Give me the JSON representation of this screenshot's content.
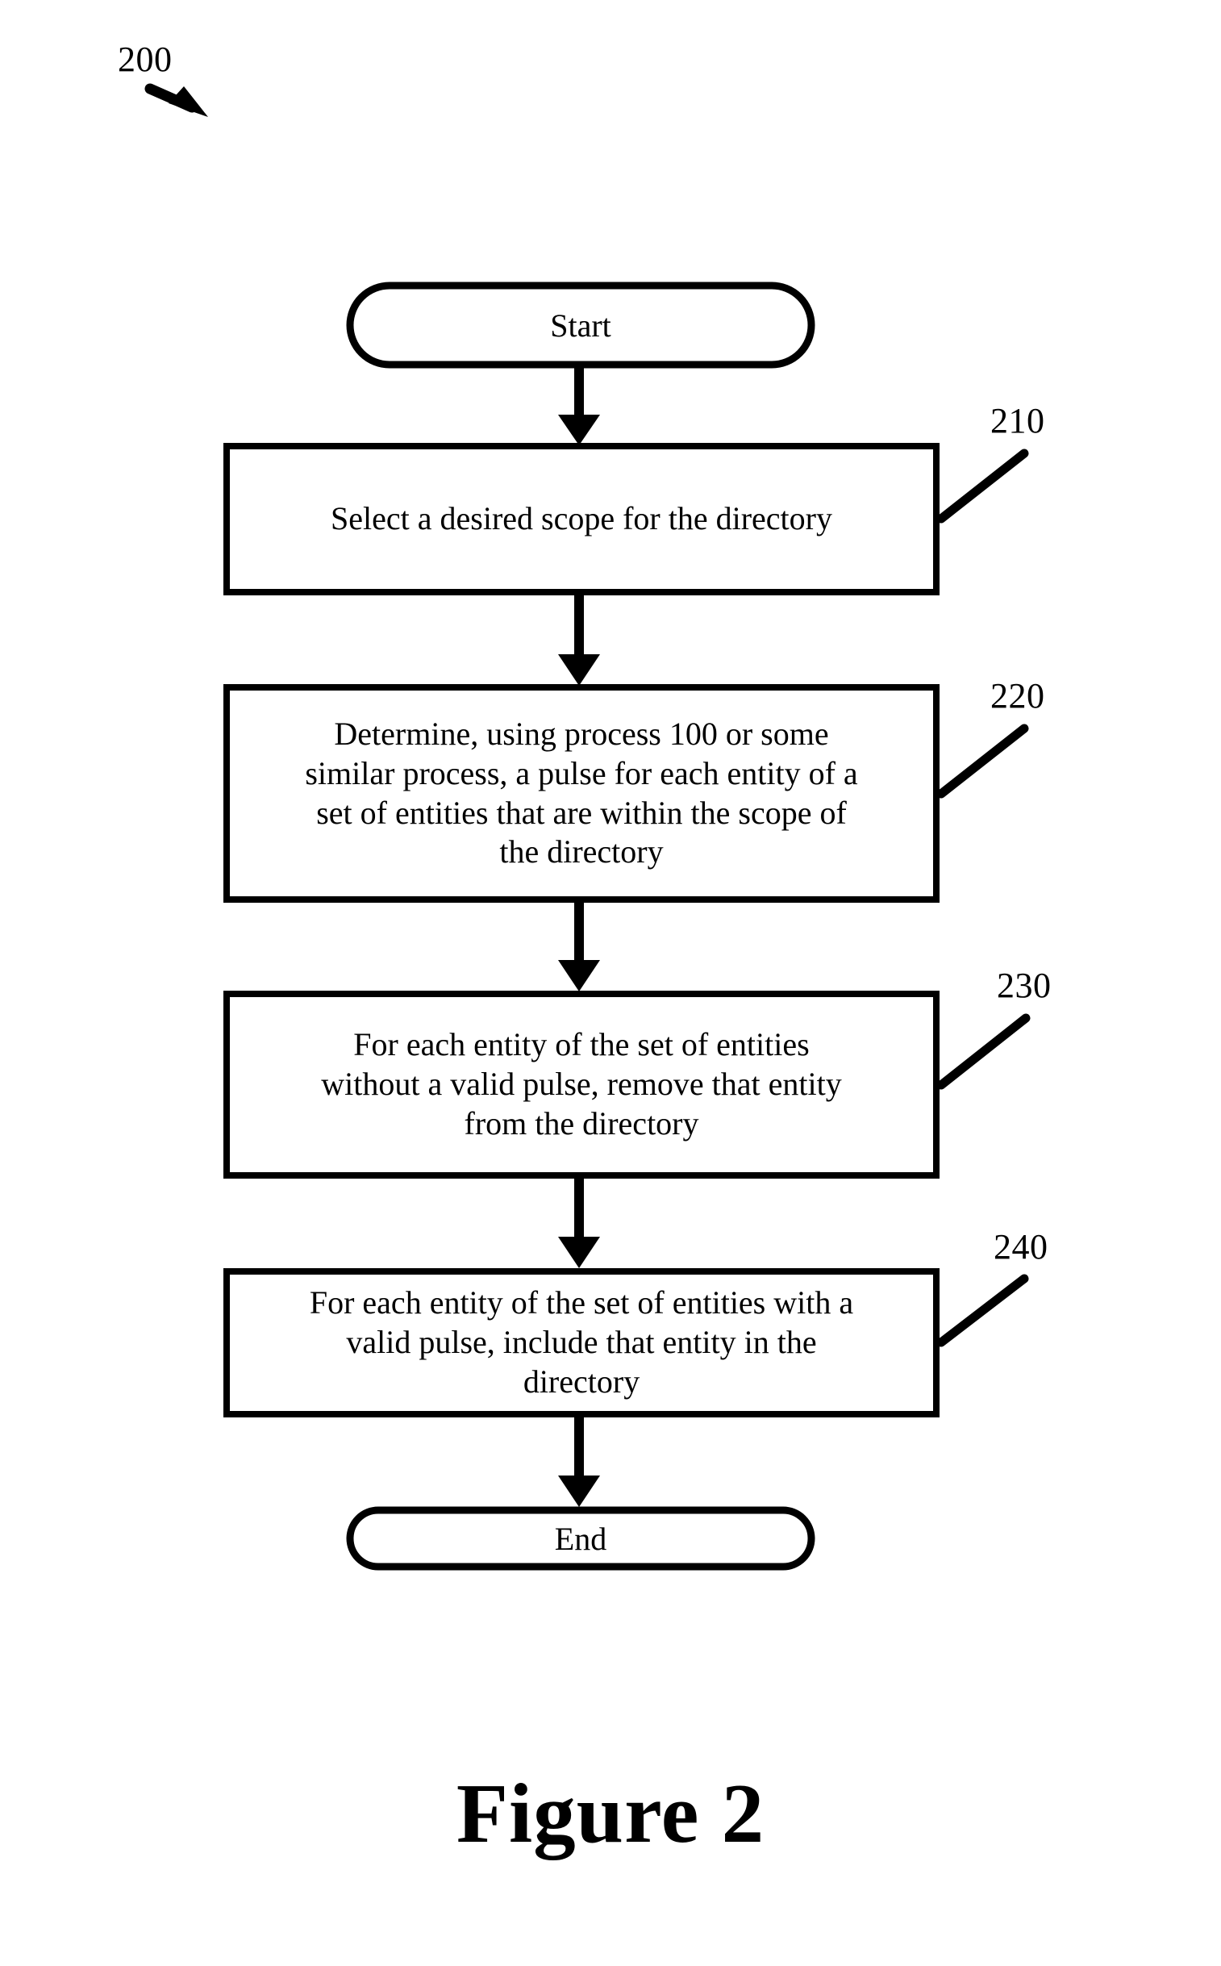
{
  "figure": {
    "caption": "Figure 2",
    "process_ref": "200"
  },
  "colors": {
    "stroke": "#000000",
    "fill": "#ffffff",
    "background": "#ffffff"
  },
  "nodes": {
    "start": {
      "label": "Start",
      "shape": "stadium"
    },
    "end": {
      "label": "End",
      "shape": "stadium"
    }
  },
  "steps": [
    {
      "ref": "210",
      "shape": "rectangle",
      "lines": [
        "Select a desired scope for the directory"
      ]
    },
    {
      "ref": "220",
      "shape": "rectangle",
      "lines": [
        "Determine, using process 100 or some",
        "similar process, a pulse for each entity of a",
        "set of entities that are within the scope of",
        "the directory"
      ]
    },
    {
      "ref": "230",
      "shape": "rectangle",
      "lines": [
        "For each entity of the set of entities",
        "without a valid pulse, remove that entity",
        "from the directory"
      ]
    },
    {
      "ref": "240",
      "shape": "rectangle",
      "lines": [
        "For each entity of the set of entities with a",
        "valid pulse, include that entity in the",
        "directory"
      ]
    }
  ],
  "connectors": [
    {
      "from": "start",
      "to": "210",
      "type": "arrow-down"
    },
    {
      "from": "210",
      "to": "220",
      "type": "arrow-down"
    },
    {
      "from": "220",
      "to": "230",
      "type": "arrow-down"
    },
    {
      "from": "230",
      "to": "240",
      "type": "arrow-down"
    },
    {
      "from": "240",
      "to": "end",
      "type": "arrow-down"
    }
  ]
}
